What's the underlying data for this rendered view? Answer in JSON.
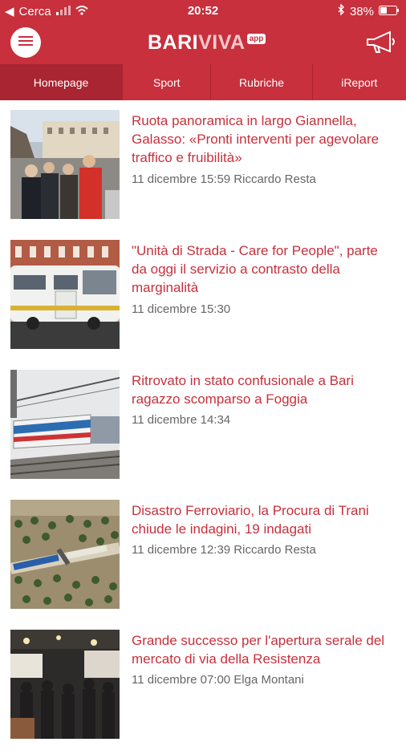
{
  "status": {
    "carrier": "Cerca",
    "time": "20:52",
    "battery": "38%"
  },
  "app": {
    "logo_main": "BARI",
    "logo_accent": "VIVA",
    "logo_badge": "app",
    "colors": {
      "brand": "#c7303c",
      "active_tab": "#a82531"
    }
  },
  "tabs": [
    {
      "label": "Homepage",
      "active": true
    },
    {
      "label": "Sport",
      "active": false
    },
    {
      "label": "Rubriche",
      "active": false
    },
    {
      "label": "iReport",
      "active": false
    }
  ],
  "articles": [
    {
      "title": "Ruota panoramica in largo Giannella, Galasso: «Pronti interventi per agevolare traffico e fruibilità»",
      "meta": "11 dicembre 15:59 Riccardo Resta"
    },
    {
      "title": "\"Unità di Strada - Care for People\", parte da oggi il servizio a contrasto della marginalità",
      "meta": "11 dicembre 15:30"
    },
    {
      "title": "Ritrovato in stato confusionale a Bari ragazzo scomparso a Foggia",
      "meta": "11 dicembre 14:34"
    },
    {
      "title": "Disastro Ferroviario, la Procura di Trani chiude le indagini, 19 indagati",
      "meta": "11 dicembre 12:39 Riccardo Resta"
    },
    {
      "title": "Grande successo per l'apertura serale del mercato di via della Resistenza",
      "meta": "11 dicembre 07:00 Elga Montani"
    }
  ]
}
